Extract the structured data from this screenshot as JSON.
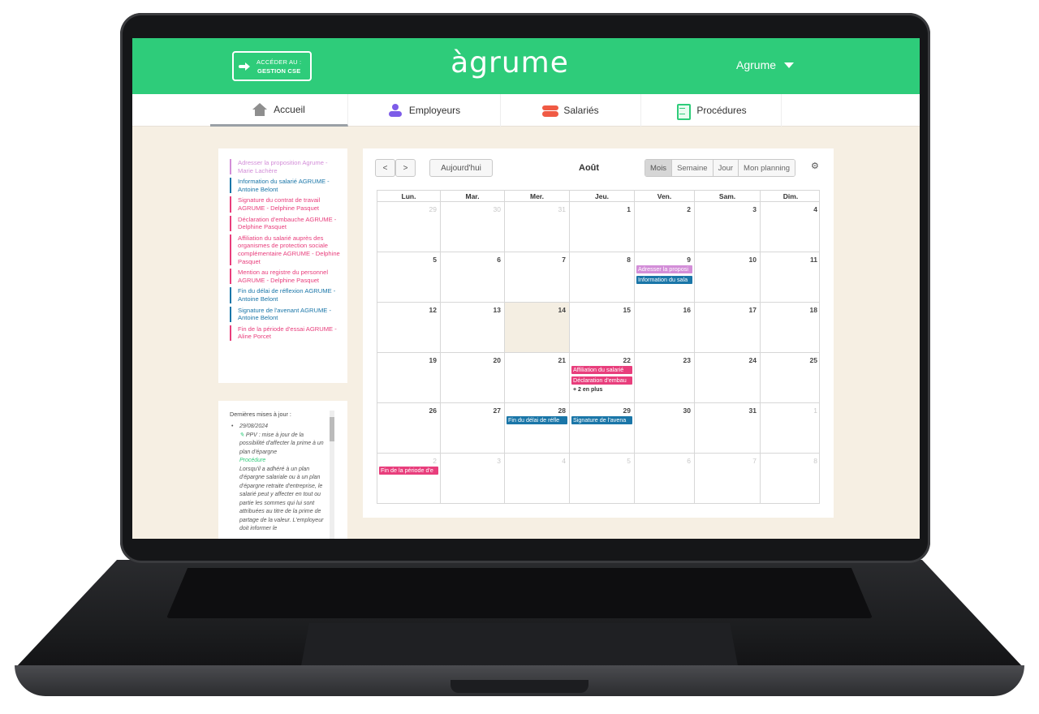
{
  "header": {
    "cse_button": {
      "line1": "ACCÉDER AU :",
      "line2": "GESTION CSE"
    },
    "logo": "àgrume",
    "user": "Agrume"
  },
  "nav": [
    {
      "label": "Accueil",
      "icon": "home-icon",
      "active": true
    },
    {
      "label": "Employeurs",
      "icon": "employers-icon",
      "active": false
    },
    {
      "label": "Salariés",
      "icon": "employees-icon",
      "active": false
    },
    {
      "label": "Procédures",
      "icon": "clipboard-icon",
      "active": false
    }
  ],
  "todo": [
    {
      "text": "Adresser la proposition Agrume - Marie Lachère",
      "color": "violet"
    },
    {
      "text": "Information du salarié AGRUME - Antoine Belont",
      "color": "blue"
    },
    {
      "text": "Signature du contrat de travail AGRUME - Delphine Pasquet",
      "color": "pink"
    },
    {
      "text": "Déclaration d'embauche AGRUME - Delphine Pasquet",
      "color": "pink"
    },
    {
      "text": "Affiliation du salarié auprès des organismes de protection sociale complémentaire AGRUME - Delphine Pasquet",
      "color": "pink"
    },
    {
      "text": "Mention au registre du personnel AGRUME - Delphine Pasquet",
      "color": "pink"
    },
    {
      "text": "Fin du délai de réflexion AGRUME - Antoine Belont",
      "color": "blue"
    },
    {
      "text": "Signature de l'avenant AGRUME - Antoine Belont",
      "color": "blue"
    },
    {
      "text": "Fin de la période d'essai AGRUME - Aline Porcet",
      "color": "pink"
    }
  ],
  "updates": {
    "title": "Dernières mises à jour :",
    "date": "29/08/2024",
    "headline": "PPV : mise à jour de la possibilité d'affecter la prime à un plan d'épargne",
    "category": "Procédure",
    "body": "Lorsqu'il a adhéré à un plan d'épargne salariale ou à un plan d'épargne retraite d'entreprise, le salarié peut y affecter en tout ou partie les sommes qui lui sont attribuées au titre de la prime de partage de la valeur. L'employeur doit informer le"
  },
  "calendar": {
    "prev": "<",
    "next": ">",
    "today_btn": "Aujourd'hui",
    "month": "Août",
    "views": [
      "Mois",
      "Semaine",
      "Jour",
      "Mon planning"
    ],
    "active_view": "Mois",
    "weekdays": [
      "Lun.",
      "Mar.",
      "Mer.",
      "Jeu.",
      "Ven.",
      "Sam.",
      "Dim."
    ],
    "weeks": [
      [
        {
          "d": "29",
          "other": true
        },
        {
          "d": "30",
          "other": true
        },
        {
          "d": "31",
          "other": true
        },
        {
          "d": "1"
        },
        {
          "d": "2"
        },
        {
          "d": "3"
        },
        {
          "d": "4"
        }
      ],
      [
        {
          "d": "5"
        },
        {
          "d": "6"
        },
        {
          "d": "7"
        },
        {
          "d": "8"
        },
        {
          "d": "9",
          "events": [
            {
              "t": "Adresser la proposi",
              "c": "violet"
            },
            {
              "t": "Information du sala",
              "c": "blue"
            }
          ]
        },
        {
          "d": "10"
        },
        {
          "d": "11"
        }
      ],
      [
        {
          "d": "12"
        },
        {
          "d": "13"
        },
        {
          "d": "14",
          "today": true
        },
        {
          "d": "15"
        },
        {
          "d": "16"
        },
        {
          "d": "17"
        },
        {
          "d": "18"
        }
      ],
      [
        {
          "d": "19"
        },
        {
          "d": "20"
        },
        {
          "d": "21"
        },
        {
          "d": "22",
          "events": [
            {
              "t": "Affiliation du salarié",
              "c": "pink"
            },
            {
              "t": "Déclaration d'embau",
              "c": "pink"
            }
          ],
          "more": "+ 2 en plus"
        },
        {
          "d": "23"
        },
        {
          "d": "24"
        },
        {
          "d": "25"
        }
      ],
      [
        {
          "d": "26"
        },
        {
          "d": "27"
        },
        {
          "d": "28",
          "events": [
            {
              "t": "Fin du délai de réfle",
              "c": "blue"
            }
          ]
        },
        {
          "d": "29",
          "events": [
            {
              "t": "Signature de l'avena",
              "c": "blue"
            }
          ]
        },
        {
          "d": "30"
        },
        {
          "d": "31"
        },
        {
          "d": "1",
          "other": true
        }
      ],
      [
        {
          "d": "2",
          "other": true,
          "events": [
            {
              "t": "Fin de la période d'e",
              "c": "pink"
            }
          ]
        },
        {
          "d": "3",
          "other": true
        },
        {
          "d": "4",
          "other": true
        },
        {
          "d": "5",
          "other": true
        },
        {
          "d": "6",
          "other": true
        },
        {
          "d": "7",
          "other": true
        },
        {
          "d": "8",
          "other": true
        }
      ]
    ]
  },
  "colors": {
    "brand_green": "#2ecc7a",
    "violet": "#d38ed8",
    "blue": "#1a76a8",
    "pink": "#e83e7c",
    "background": "#f6efe3"
  }
}
